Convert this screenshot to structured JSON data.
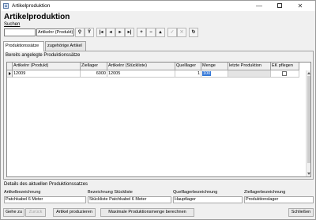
{
  "window": {
    "title": "Artikelproduktion"
  },
  "header": {
    "title": "Artikelproduktion"
  },
  "search": {
    "label": "Suchen",
    "value": "",
    "field_selected": "Artikelnr (Produkt)"
  },
  "toolbar": {
    "buttons": [
      {
        "icon": "binoculars-icon",
        "glyph": "⚲",
        "enabled": true
      },
      {
        "icon": "filter-icon",
        "glyph": "Ÿ",
        "enabled": true
      },
      {
        "icon": "first-record-icon",
        "glyph": "|◂",
        "enabled": true
      },
      {
        "icon": "previous-record-icon",
        "glyph": "◂",
        "enabled": true
      },
      {
        "icon": "next-record-icon",
        "glyph": "▸",
        "enabled": true
      },
      {
        "icon": "last-record-icon",
        "glyph": "▸|",
        "enabled": true
      },
      {
        "icon": "add-icon",
        "glyph": "+",
        "enabled": true
      },
      {
        "icon": "remove-icon",
        "glyph": "−",
        "enabled": true
      },
      {
        "icon": "up-icon",
        "glyph": "▴",
        "enabled": true
      },
      {
        "icon": "confirm-icon",
        "glyph": "✓",
        "enabled": false
      },
      {
        "icon": "cancel-icon",
        "glyph": "✕",
        "enabled": false
      },
      {
        "icon": "refresh-icon",
        "glyph": "↻",
        "enabled": true
      }
    ]
  },
  "tabs": [
    {
      "label": "Produktionssätze",
      "active": true
    },
    {
      "label": "zugehörige Artikel",
      "active": false
    }
  ],
  "grid": {
    "caption": "Bereits angelegte Produktionssätze",
    "columns": [
      "Artikelnr (Produkt)",
      "Ziellager",
      "Artikelnr (Stückliste)",
      "Quelllager",
      "Menge",
      "letzte Produktion",
      "EK pflegen"
    ],
    "rows": [
      {
        "artikelnr_produkt": "12009",
        "ziellager": "6000",
        "artikelnr_stueckliste": "12005",
        "quelllager": "1",
        "menge": "100",
        "letzte_produktion": "",
        "ek_pflegen": false
      }
    ]
  },
  "details": {
    "title": "Details des aktuellen Produktionssatzes",
    "fields": [
      {
        "label": "Artikelbezeichnung",
        "value": "Patchkabel 6 Meter"
      },
      {
        "label": "Bezeichnung Stückliste",
        "value": "Stückliste Patchkabel 6 Meter"
      },
      {
        "label": "Quelllagerbezeichnung",
        "value": "Hauptlager"
      },
      {
        "label": "Ziellagerbezeichnung",
        "value": "Produktionslager"
      }
    ]
  },
  "buttons": {
    "goto": "Gehe zu",
    "back": "Zurück",
    "produce": "Artikel produzieren",
    "max_qty": "Maximale Produktionsmenge berechnen",
    "close": "Schließen"
  }
}
